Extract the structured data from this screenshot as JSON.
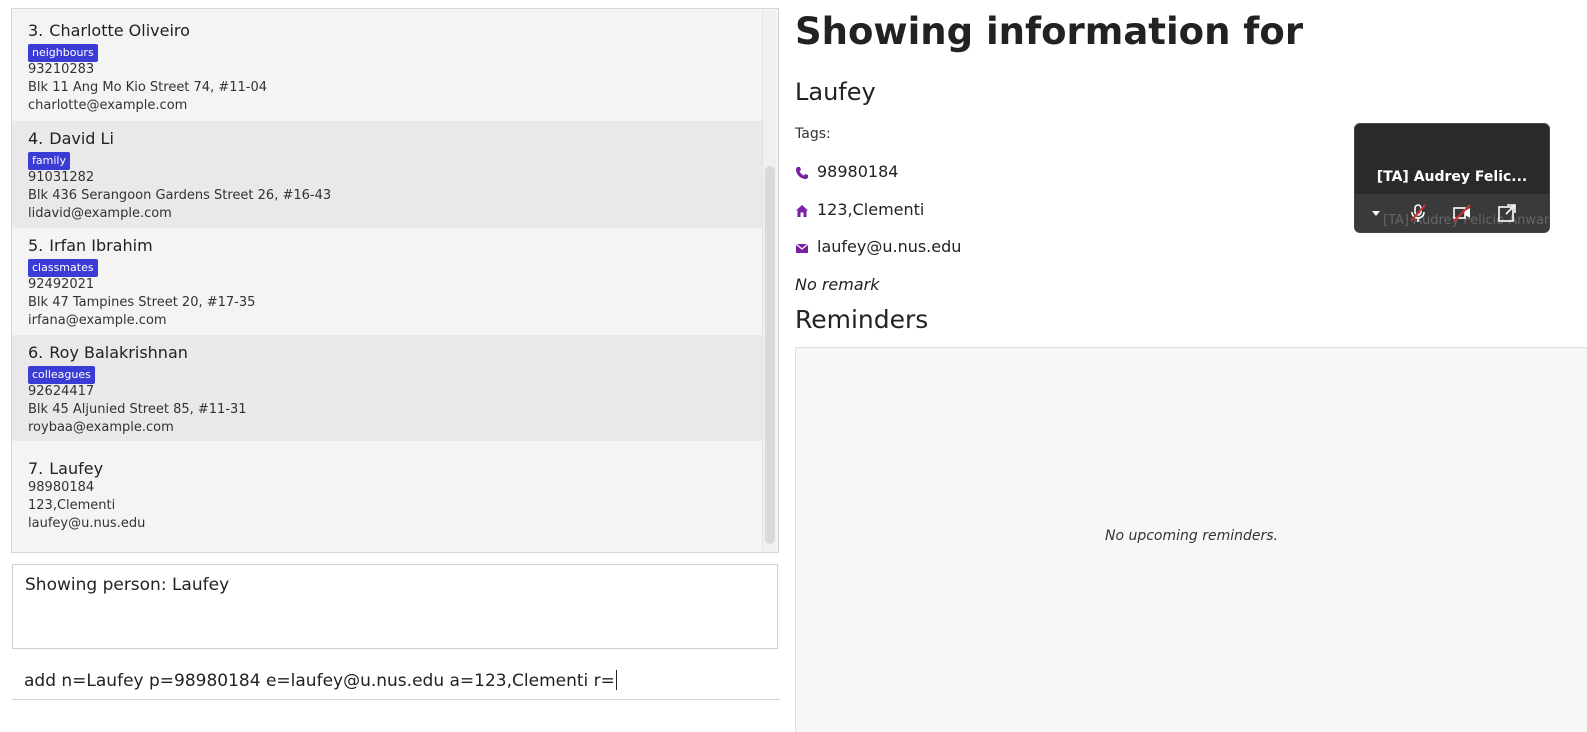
{
  "persons": [
    {
      "index": "3.",
      "name": "Charlotte Oliveiro",
      "tag": "neighbours",
      "phone": "93210283",
      "address": "Blk 11 Ang Mo Kio Street 74, #11-04",
      "email": "charlotte@example.com"
    },
    {
      "index": "4.",
      "name": "David Li",
      "tag": "family",
      "phone": "91031282",
      "address": "Blk 436 Serangoon Gardens Street 26, #16-43",
      "email": "lidavid@example.com"
    },
    {
      "index": "5.",
      "name": "Irfan Ibrahim",
      "tag": "classmates",
      "phone": "92492021",
      "address": "Blk 47 Tampines Street 20, #17-35",
      "email": "irfana@example.com"
    },
    {
      "index": "6.",
      "name": "Roy Balakrishnan",
      "tag": "colleagues",
      "phone": "92624417",
      "address": "Blk 45 Aljunied Street 85, #11-31",
      "email": "roybaa@example.com"
    },
    {
      "index": "7.",
      "name": "Laufey",
      "tag": "",
      "phone": "98980184",
      "address": "123,Clementi",
      "email": "laufey@u.nus.edu"
    }
  ],
  "result": {
    "text": "Showing person: Laufey"
  },
  "command": {
    "text": "add n=Laufey p=98980184 e=laufey@u.nus.edu a=123,Clementi r="
  },
  "detail": {
    "title": "Showing information for",
    "name": "Laufey",
    "tags_label": "Tags:",
    "phone": "98980184",
    "address": "123,Clementi",
    "email": "laufey@u.nus.edu",
    "remark": "No remark",
    "reminders_heading": "Reminders",
    "reminders_empty": "No upcoming reminders."
  },
  "video": {
    "title": "[TA] Audrey Felic...",
    "ghost_text": "[TA] Audrey Felicio Anwar"
  },
  "colors": {
    "tag_bg": "#3b3bd6",
    "icon_purple": "#7a1fa2"
  }
}
